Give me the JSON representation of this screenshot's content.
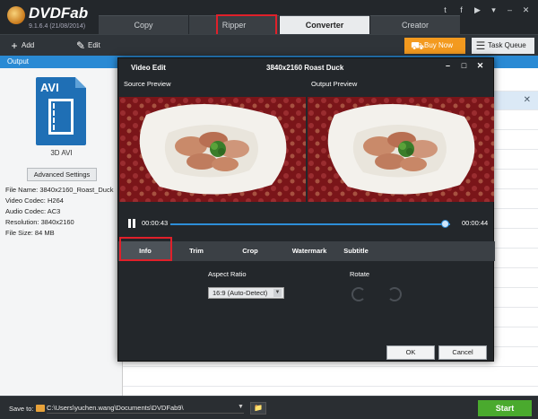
{
  "header": {
    "brand": "DVDFab",
    "version": "9.1.6.4 (21/08/2014)",
    "tabs": [
      {
        "label": "Copy"
      },
      {
        "label": "Ripper"
      },
      {
        "label": "Converter"
      },
      {
        "label": "Creator"
      }
    ],
    "active_tab": "Converter",
    "social_icons": [
      "twitter-icon",
      "facebook-icon",
      "youtube-icon",
      "menu-icon",
      "minimize-icon",
      "close-icon"
    ]
  },
  "toolbar": {
    "add_label": "Add",
    "edit_label": "Edit",
    "buy_label": "Buy Now",
    "task_label": "Task Queue"
  },
  "output_label": "Output",
  "file": {
    "format_badge": "AVI",
    "caption": "3D AVI",
    "advanced_button": "Advanced Settings",
    "info": [
      "File Name: 3840x2160_Roast_Duck",
      "Video Codec: H264",
      "Audio Codec: AC3",
      "Resolution: 3840x2160",
      "File Size: 84 MB"
    ]
  },
  "video_edit": {
    "title": "Video Edit",
    "resolution_title": "3840x2160  Roast  Duck",
    "source_label": "Source Preview",
    "output_label": "Output Preview",
    "time_current": "00:00:43",
    "time_end": "00:00:44",
    "progress_fraction": 0.98,
    "tabs": [
      {
        "label": "Info"
      },
      {
        "label": "Trim"
      },
      {
        "label": "Crop"
      },
      {
        "label": "Watermark"
      },
      {
        "label": "Subtitle"
      }
    ],
    "active_tab": "Info",
    "aspect_ratio_label": "Aspect Ratio",
    "aspect_ratio_value": "16:9 (Auto-Detect)",
    "rotate_label": "Rotate",
    "ok_label": "OK",
    "cancel_label": "Cancel"
  },
  "footer": {
    "save_label": "Save to:",
    "path": "C:\\Users\\yuchen.wang\\Documents\\DVDFab9\\",
    "start_label": "Start"
  },
  "colors": {
    "accent_blue": "#2a8ad4",
    "buy_orange": "#f39a1f",
    "start_green": "#4aaa2e",
    "highlight_red": "#e0202a"
  }
}
